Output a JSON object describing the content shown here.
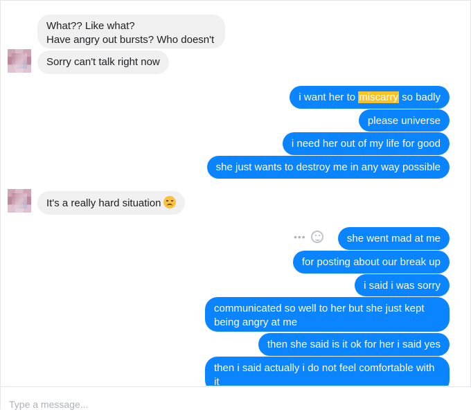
{
  "messages": {
    "m1": {
      "line1": "What?? Like what?",
      "line2": "Have angry out bursts? Who doesn't"
    },
    "m2": "Sorry can't talk right now",
    "m3": {
      "before": "i want her to ",
      "highlight": "miscarry",
      "after": " so badly"
    },
    "m4": "please universe",
    "m5": "i need her out of my life for good",
    "m6": "she just wants to destroy me in any way possible",
    "m7": "It's a really hard situation",
    "m7_emoji": "disappointed-face-emoji",
    "m8": "she went mad at me",
    "m9": "for posting about our break up",
    "m10": "i said i was sorry",
    "m11": "communicated so well to her but she just kept being angry at me",
    "m12": "then she said is it ok for her i said yes",
    "m13": "then i said actually i do not feel comfortable with it"
  },
  "actions": {
    "more_label": "•••",
    "react_icon": "smiley-react-icon"
  },
  "composer": {
    "placeholder": "Type a message..."
  },
  "colors": {
    "outgoing": "#0a84ff",
    "incoming": "#f1f0f0",
    "highlight": "#f9c326"
  }
}
